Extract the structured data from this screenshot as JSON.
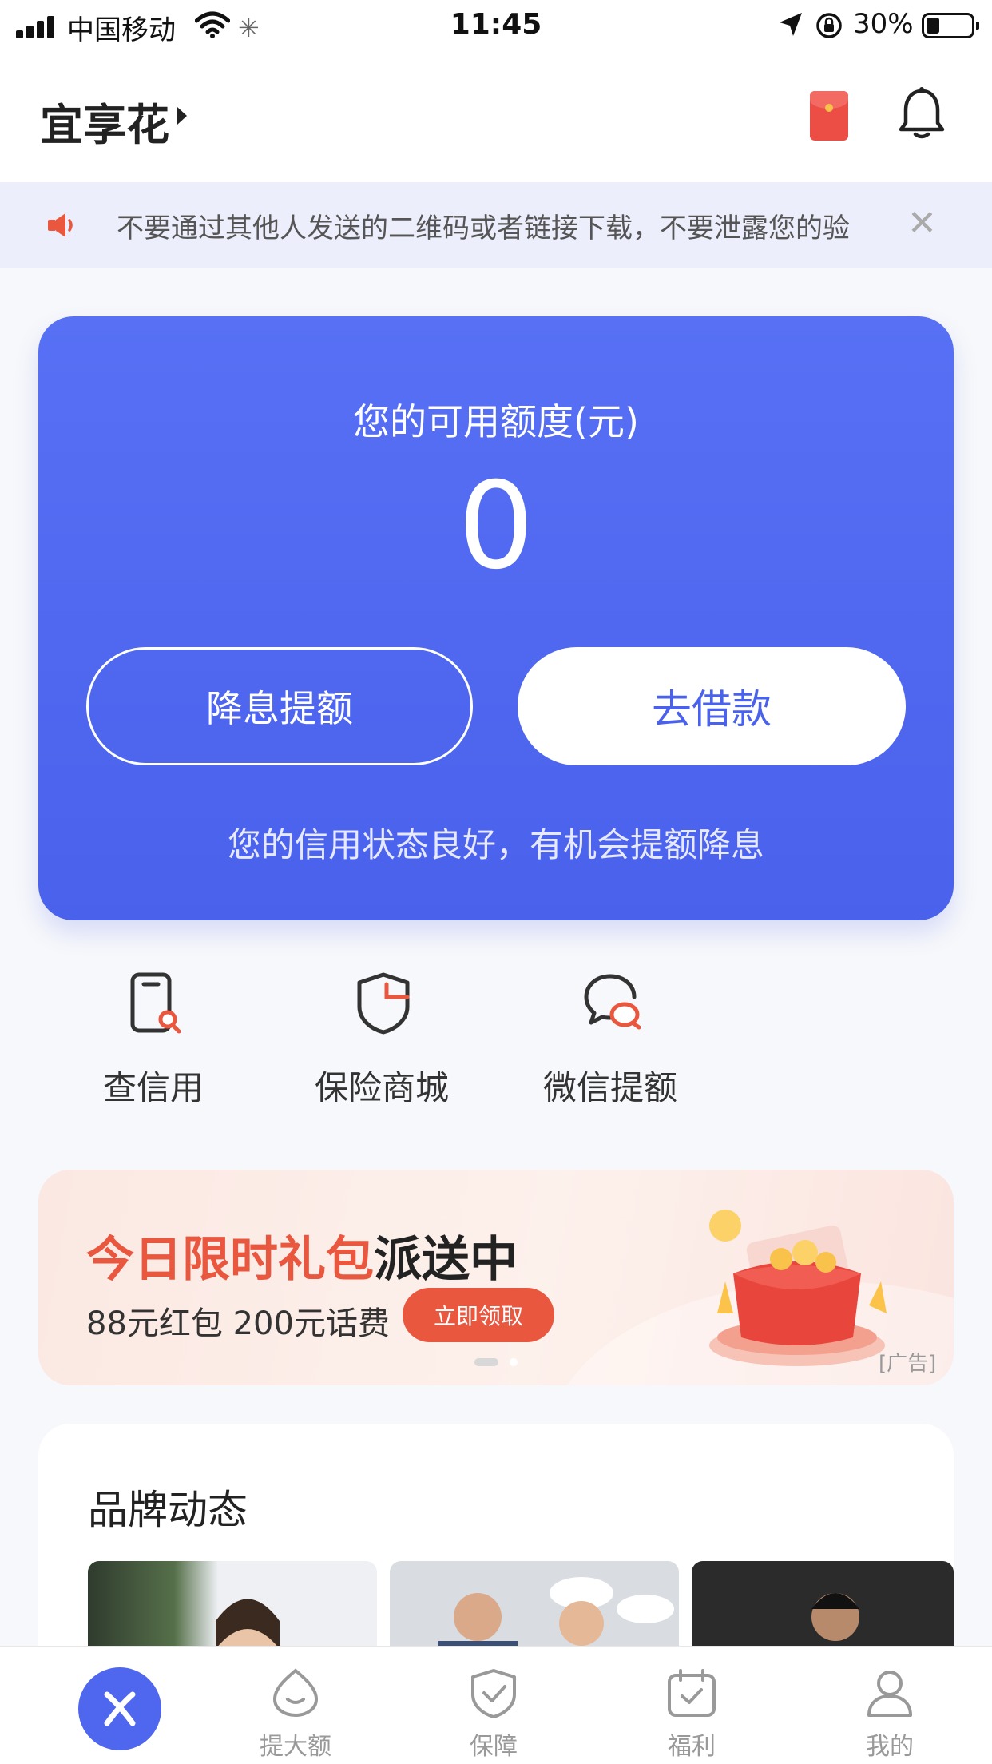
{
  "status_bar": {
    "carrier": "中国移动",
    "time": "11:45",
    "battery_text": "30%"
  },
  "header": {
    "title": "宜享花"
  },
  "notice": {
    "text": "不要通过其他人发送的二维码或者链接下载，不要泄露您的验"
  },
  "credit": {
    "label": "您的可用额度(元)",
    "amount": "0",
    "btn_raise": "降息提额",
    "btn_borrow": "去借款",
    "tip": "您的信用状态良好，有机会提额降息"
  },
  "quick_actions": [
    {
      "label": "查信用",
      "icon": "credit-check-icon"
    },
    {
      "label": "保险商城",
      "icon": "insurance-shield-icon"
    },
    {
      "label": "微信提额",
      "icon": "wechat-chat-icon"
    }
  ],
  "banner": {
    "headline_red": "今日限时礼包",
    "headline_dark": "派送中",
    "sub": "88元红包 200元话费",
    "cta": "立即领取",
    "ad_tag": "[广告]",
    "page_index": 1,
    "page_count": 2
  },
  "brand": {
    "title": "品牌动态"
  },
  "tabbar": {
    "items": [
      {
        "label": "",
        "icon": "home-logo-icon"
      },
      {
        "label": "提大额",
        "icon": "smile-icon"
      },
      {
        "label": "保障",
        "icon": "shield-check-icon"
      },
      {
        "label": "福利",
        "icon": "calendar-check-icon"
      },
      {
        "label": "我的",
        "icon": "user-icon"
      }
    ]
  },
  "colors": {
    "primary": "#4a61ec",
    "accent_red": "#e9573f",
    "background": "#f7f8fb"
  }
}
